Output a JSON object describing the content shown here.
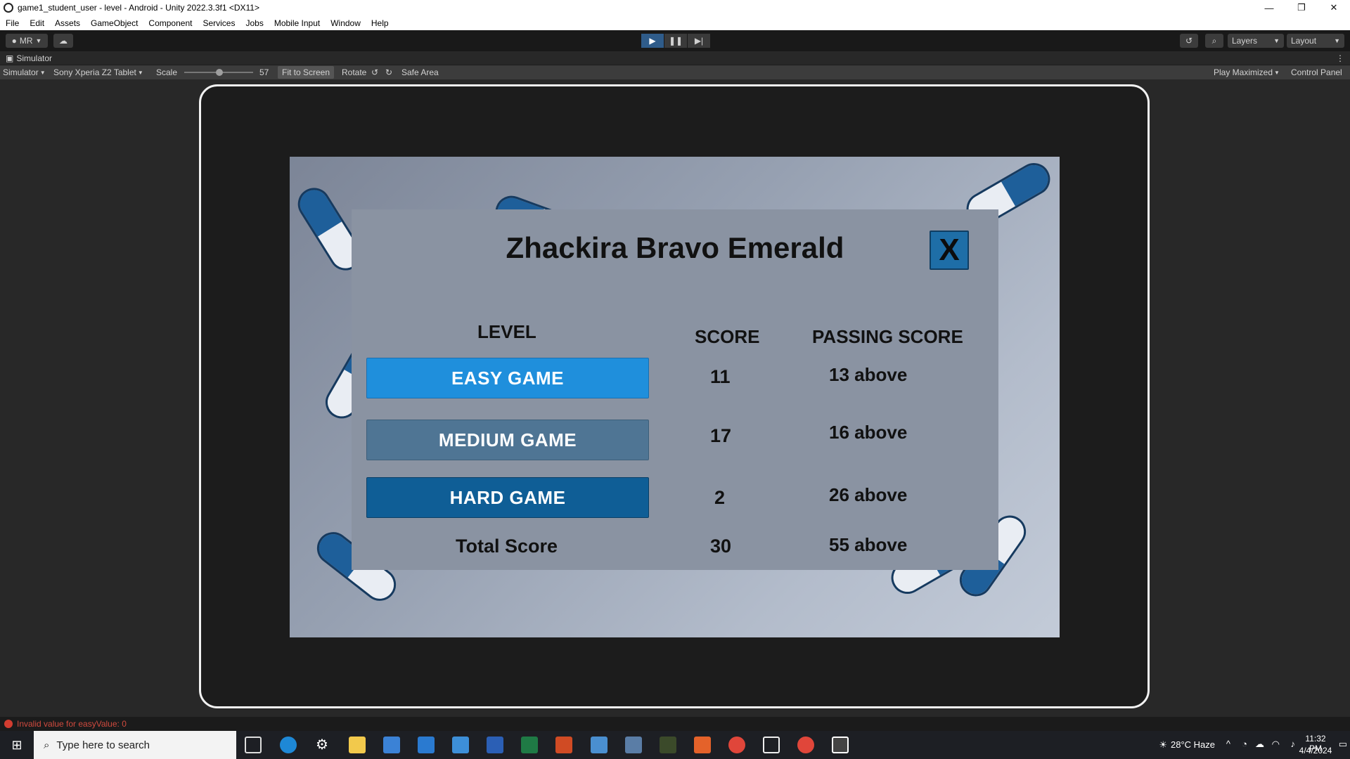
{
  "window": {
    "title": "game1_student_user - level - Android - Unity 2022.3.3f1 <DX11>",
    "controls": [
      "—",
      "❐",
      "✕"
    ]
  },
  "menu": [
    "File",
    "Edit",
    "Assets",
    "GameObject",
    "Component",
    "Services",
    "Jobs",
    "Mobile Input",
    "Window",
    "Help"
  ],
  "toolbar": {
    "account": "MR",
    "layers": "Layers",
    "layout": "Layout"
  },
  "simulator": {
    "tab_label": "Simulator",
    "mode": "Simulator",
    "device": "Sony Xperia Z2 Tablet",
    "scale_label": "Scale",
    "scale_value": "57",
    "fit_to_screen": "Fit to Screen",
    "rotate": "Rotate",
    "safe_area": "Safe Area",
    "play_mode": "Play Maximized",
    "control_panel": "Control Panel"
  },
  "game": {
    "player_name": "Zhackira Bravo Emerald",
    "close_label": "X",
    "headers": {
      "level": "LEVEL",
      "score": "SCORE",
      "passing": "PASSING  SCORE"
    },
    "rows": [
      {
        "label": "EASY GAME",
        "score": "11",
        "passing": "13 above",
        "color": "#1f8fdc"
      },
      {
        "label": "MEDIUM  GAME",
        "score": "17",
        "passing": "16 above",
        "color": "#4f7594"
      },
      {
        "label": "HARD  GAME",
        "score": "2",
        "passing": "26 above",
        "color": "#0f5e96"
      }
    ],
    "total": {
      "label": "Total Score",
      "score": "30",
      "passing": "55 above"
    }
  },
  "console": {
    "error": "Invalid value for easyValue: 0"
  },
  "taskbar": {
    "search_placeholder": "Type here to search",
    "weather": "28°C  Haze",
    "time": "11:32 PM",
    "date": "4/4/2024"
  }
}
